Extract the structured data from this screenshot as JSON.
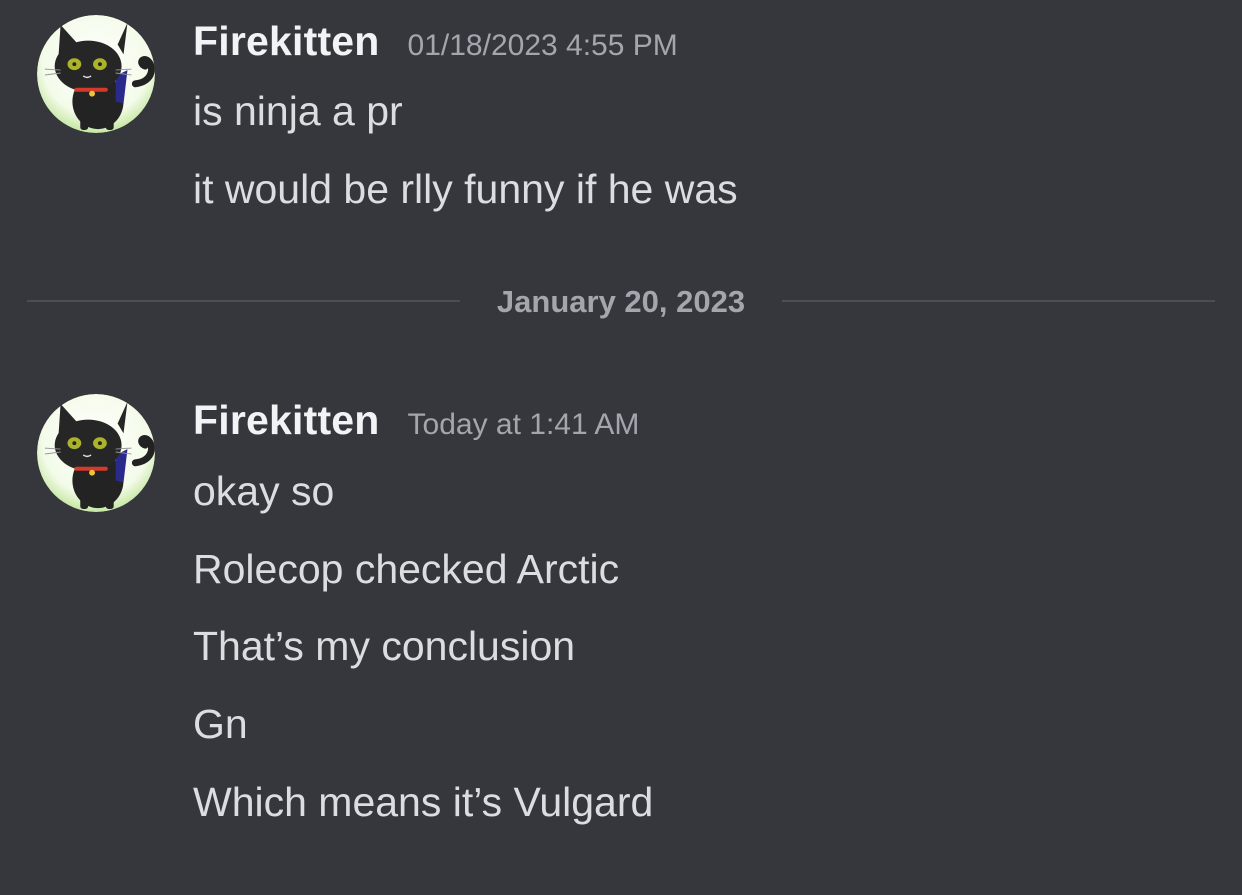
{
  "messages": [
    {
      "author": "Firekitten",
      "timestamp": "01/18/2023 4:55 PM",
      "lines": [
        "is ninja a pr",
        "it would be rlly funny if he was"
      ]
    },
    {
      "author": "Firekitten",
      "timestamp": "Today at 1:41 AM",
      "lines": [
        "okay so",
        "Rolecop checked Arctic",
        "That’s my conclusion",
        "Gn",
        "Which means it’s Vulgard"
      ]
    }
  ],
  "date_divider": "January 20, 2023",
  "colors": {
    "background": "#36373d",
    "username": "#f2f3f5",
    "message_text": "#dbdee1",
    "muted": "#a3a6ad",
    "divider": "#4c4e55"
  },
  "icons": {
    "avatar": "black-cat-avatar"
  }
}
